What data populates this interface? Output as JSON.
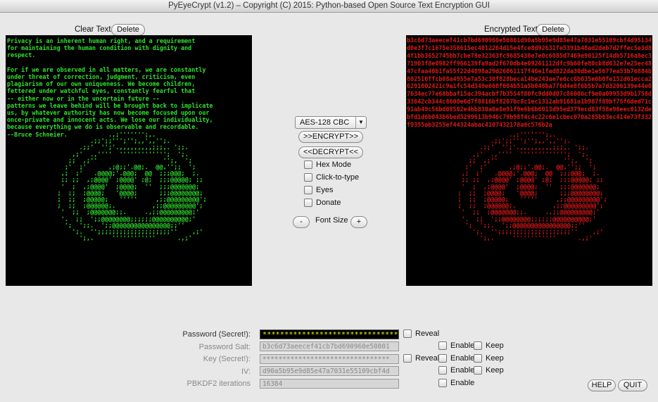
{
  "title": "PyEyeCrypt (v1.2)  –  Copyright (C) 2015:  Python-based Open Source Text Encryption GUI",
  "clear_panel": {
    "label": "Clear Text",
    "delete_label": "Delete",
    "text": "Privacy is an inherent human right, and a requirement\nfor maintaining the human condition with dignity and\nrespect.\n\nFor if we are observed in all matters, we are constantly\nunder threat of correction, judgment, criticism, even\nplagiarism of our own uniqueness. We become children,\nfettered under watchful eyes, constantly fearful that\n-- either now or in the uncertain future --\npatterns we leave behind will be brought back to implicate\nus, by whatever authority has now become focused upon our\nonce-private and innocent acts. We lose our individuality,\nbecause everything we do is observable and recordable.\n--Bruce Schneier.",
    "color": "#2ee22e"
  },
  "encrypted_panel": {
    "label": "Encrypted Text",
    "delete_label": "Delete",
    "text": "b3c6d73aeecef41cb7bd690960e50801d90a5b95e9d85e47a7031e55109cbf4d95134d0e3f7c1675e358615ec4012264d15e4fce8d92631fe5391b48ad2deb7d2ffec5e3d84f1bb3652745bb7cbe78e32363fc9685430e7e0c6085d7469e90125f14db5716a8ec371903f8e0982ff966139fa9ad2f670db4e09261112dfc9b60fe80cb8d632e7e25ec4847cfaa40b1fa55f22d4898a29d26061117f46e1fad822da30dbe1e5677ea53b76884b802510ffcb08a4955e7a53c30f828beca14be243ae7e6cc6b035e0b0fe152d61ecca26291002421c9a1fc54d349e668f604b51a5b048ba776d4e8f6b5b7a7d3206139e44e07634ec77e68bbaf15ac394acbf7b3554f80fc9dd0d07c86006cf9e0a09953d9b1758d33642cb344c8600e6d7f8816bf8207bc8c1ec1312ab91681a1b987f89bf75f6ded71c91ab49c56bd08502e4bb830a6e8e91f9e6b6b6013d95ed379ecd83f58e96eec0132debfd1d6b043b6bed5299613b946c79b98f4c4c22c6e1cbec070a285b63ec414e73f332f9355ab3255ef44324abac4107432178a6c576b2a",
    "color": "#e01818"
  },
  "controls": {
    "cipher_selected": "AES-128 CBC",
    "encrypt_label": ">>ENCRYPT>>",
    "decrypt_label": "<<DECRYPT<<",
    "options": [
      "Hex Mode",
      "Click-to-type",
      "Eyes",
      "Donate"
    ],
    "font_minus": "-",
    "font_label": "Font Size",
    "font_plus": "+"
  },
  "form": {
    "password_label": "Password (Secret!):",
    "password_value": "**************************************************",
    "password_reveal": "Reveal",
    "salt_label": "Password Salt:",
    "salt_value": "b3c6d73aeecef41cb7bd690960e50801",
    "salt_enable": "Enable",
    "salt_keep": "Keep",
    "key_label": "Key (Secret!):",
    "key_value": "********************************",
    "key_reveal": "Reveal",
    "key_enable": "Enable",
    "key_keep": "Keep",
    "iv_label": "IV:",
    "iv_value": "d90a5b95e9d85e47a7031e55109cbf4d",
    "iv_enable": "Enable",
    "iv_keep": "Keep",
    "pbkdf2_label": "PBKDF2 iterations",
    "pbkdf2_value": "16384",
    "pbkdf2_enable": "Enable"
  },
  "help_label": "HELP",
  "quit_label": "QUIT"
}
